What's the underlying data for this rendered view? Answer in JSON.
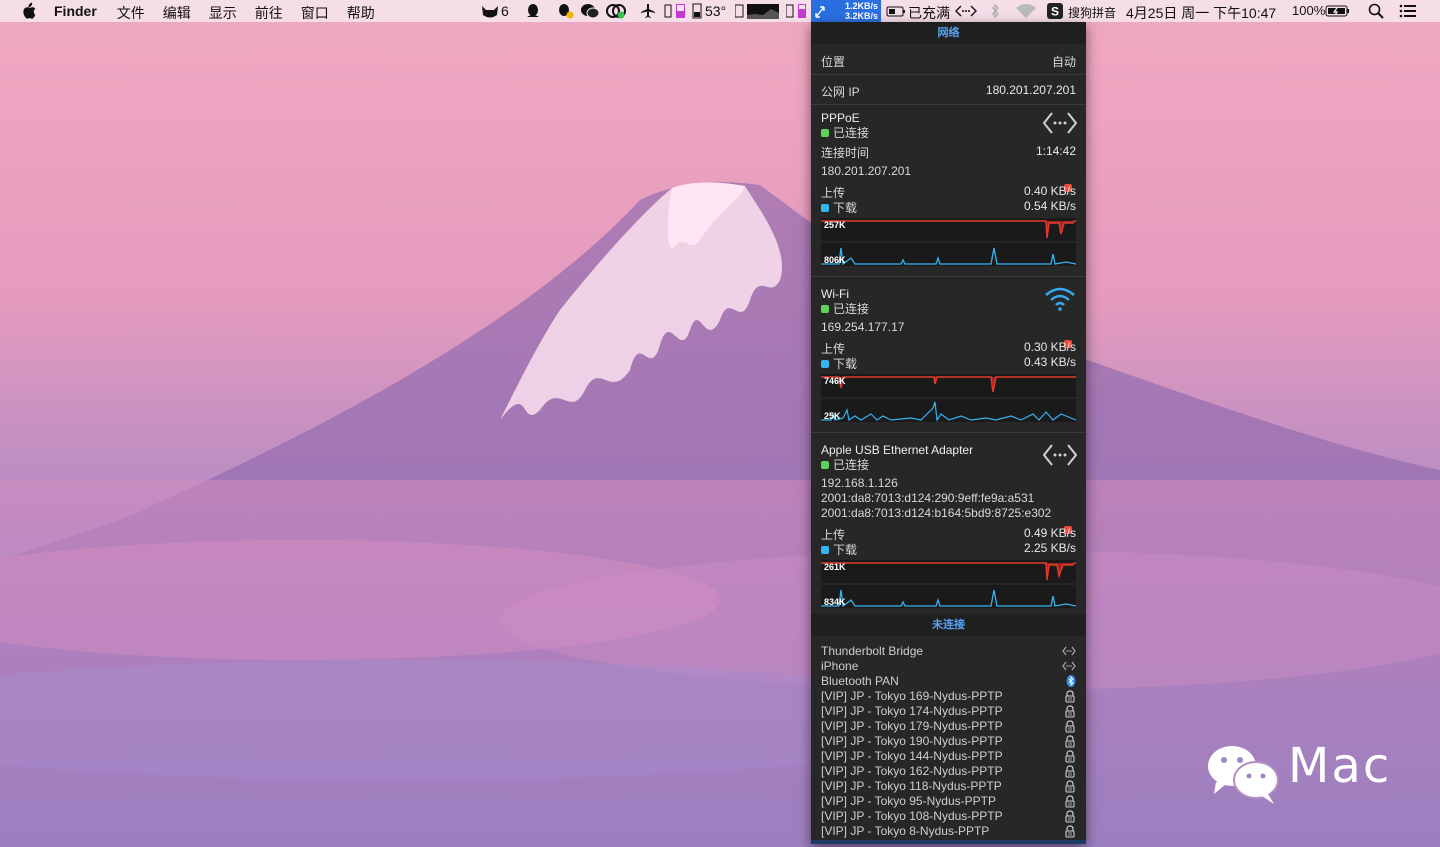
{
  "menubar": {
    "app_name": "Finder",
    "menus": [
      "文件",
      "编辑",
      "显示",
      "前往",
      "窗口",
      "帮助"
    ],
    "status": {
      "badge_count": "6",
      "temperature": "53°",
      "upload_speed": "1.2KB/s",
      "download_speed": "3.2KB/s",
      "charge_state": "已充满",
      "input_method": "搜狗拼音",
      "datetime": "4月25日 周一 下午10:47",
      "battery": "100%"
    }
  },
  "panel": {
    "title": "网络",
    "location_label": "位置",
    "location_value": "自动",
    "public_ip_label": "公网 IP",
    "public_ip_value": "180.201.207.201",
    "interfaces": [
      {
        "name": "PPPoE",
        "status": "已连接",
        "time_label": "连接时间",
        "time_value": "1:14:42",
        "ips": [
          "180.201.207.201"
        ],
        "up_label": "上传",
        "up_value": "0.40 KB/s",
        "down_label": "下载",
        "down_value": "0.54 KB/s",
        "graph_top": "257K",
        "graph_bottom": "806K"
      },
      {
        "name": "Wi-Fi",
        "status": "已连接",
        "ips": [
          "169.254.177.17"
        ],
        "up_label": "上传",
        "up_value": "0.30 KB/s",
        "down_label": "下载",
        "down_value": "0.43 KB/s",
        "graph_top": "746K",
        "graph_bottom": "25K"
      },
      {
        "name": "Apple USB Ethernet Adapter",
        "status": "已连接",
        "ips": [
          "192.168.1.126",
          "2001:da8:7013:d124:290:9eff:fe9a:a531",
          "2001:da8:7013:d124:b164:5bd9:8725:e302"
        ],
        "up_label": "上传",
        "up_value": "0.49 KB/s",
        "down_label": "下载",
        "down_value": "2.25 KB/s",
        "graph_top": "261K",
        "graph_bottom": "834K"
      }
    ],
    "disconnected_title": "未连接",
    "disconnected": [
      {
        "name": "Thunderbolt Bridge",
        "icon": "ethernet-icon"
      },
      {
        "name": "iPhone",
        "icon": "ethernet-icon"
      },
      {
        "name": "Bluetooth PAN",
        "icon": "bluetooth-icon"
      },
      {
        "name": "[VIP] JP - Tokyo 169-Nydus-PPTP",
        "icon": "vpn-lock-icon"
      },
      {
        "name": "[VIP] JP - Tokyo 174-Nydus-PPTP",
        "icon": "vpn-lock-icon"
      },
      {
        "name": "[VIP] JP - Tokyo 179-Nydus-PPTP",
        "icon": "vpn-lock-icon"
      },
      {
        "name": "[VIP] JP - Tokyo 190-Nydus-PPTP",
        "icon": "vpn-lock-icon"
      },
      {
        "name": "[VIP] JP - Tokyo 144-Nydus-PPTP",
        "icon": "vpn-lock-icon"
      },
      {
        "name": "[VIP] JP - Tokyo 162-Nydus-PPTP",
        "icon": "vpn-lock-icon"
      },
      {
        "name": "[VIP] JP - Tokyo 118-Nydus-PPTP",
        "icon": "vpn-lock-icon"
      },
      {
        "name": "[VIP] JP - Tokyo 95-Nydus-PPTP",
        "icon": "vpn-lock-icon"
      },
      {
        "name": "[VIP] JP - Tokyo 108-Nydus-PPTP",
        "icon": "vpn-lock-icon"
      },
      {
        "name": "[VIP] JP - Tokyo 8-Nydus-PPTP",
        "icon": "vpn-lock-icon"
      }
    ]
  },
  "watermark": {
    "text": "Mac"
  },
  "colors": {
    "upload": "#ef4a3c",
    "download": "#35b4f2",
    "connected": "#5ed15b",
    "accent": "#5aa2f0"
  }
}
